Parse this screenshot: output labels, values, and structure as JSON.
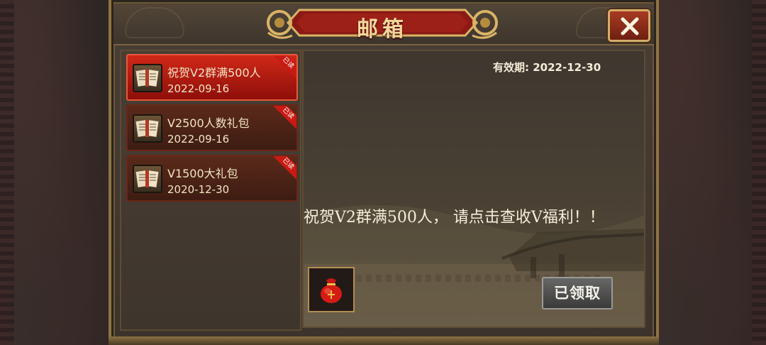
{
  "window": {
    "title": "邮箱"
  },
  "close_icon": "close-x-icon",
  "mails": [
    {
      "title": "祝贺V2群满500人",
      "date": "2022-09-16",
      "read_tag": "已读",
      "icon": "letter-scroll-icon"
    },
    {
      "title": "V2500人数礼包",
      "date": "2022-09-16",
      "read_tag": "已读",
      "icon": "letter-scroll-icon"
    },
    {
      "title": "V1500大礼包",
      "date": "2020-12-30",
      "read_tag": "已读",
      "icon": "letter-scroll-icon"
    }
  ],
  "selected_mail_index": 0,
  "detail": {
    "expiry": "有效期: 2022-12-30",
    "message": "祝贺V2群满500人，  请点击查收V福利！！",
    "reward_icon": "red-money-bag-icon",
    "claim_label": "已领取",
    "claim_state": "claimed"
  },
  "colors": {
    "selected_row": "#d02818",
    "row": "#5a2a1a",
    "title_text": "#f3d79a",
    "gold_border": "#d2ae6a"
  }
}
